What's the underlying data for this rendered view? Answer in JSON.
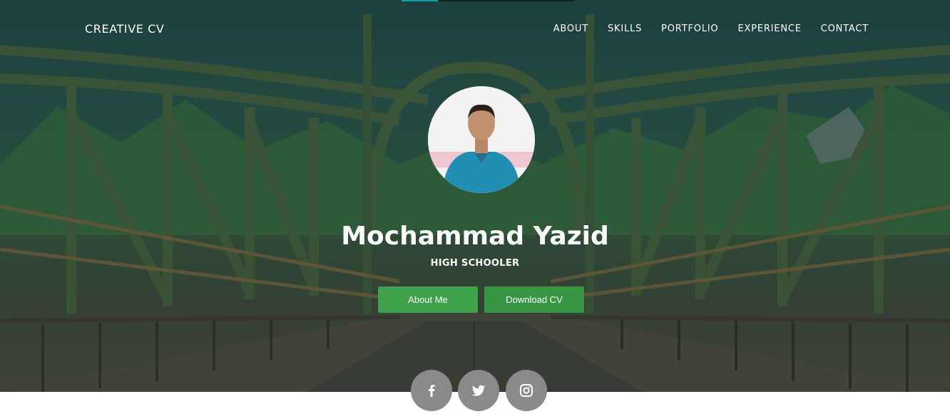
{
  "header": {
    "brand": "CREATIVE CV",
    "nav": [
      "ABOUT",
      "SKILLS",
      "PORTFOLIO",
      "EXPERIENCE",
      "CONTACT"
    ]
  },
  "scroll_progress": 0.21,
  "profile": {
    "name": "Mochammad Yazid",
    "role": "HIGH SCHOOLER",
    "avatar_alt": "avatar"
  },
  "buttons": {
    "about": "About Me",
    "download": "Download CV"
  },
  "social": [
    "facebook-icon",
    "twitter-icon",
    "instagram-icon"
  ],
  "colors": {
    "accent_green": "#3ea24a",
    "progress": "#16a0a6",
    "social_bg": "#8a8a8a"
  }
}
